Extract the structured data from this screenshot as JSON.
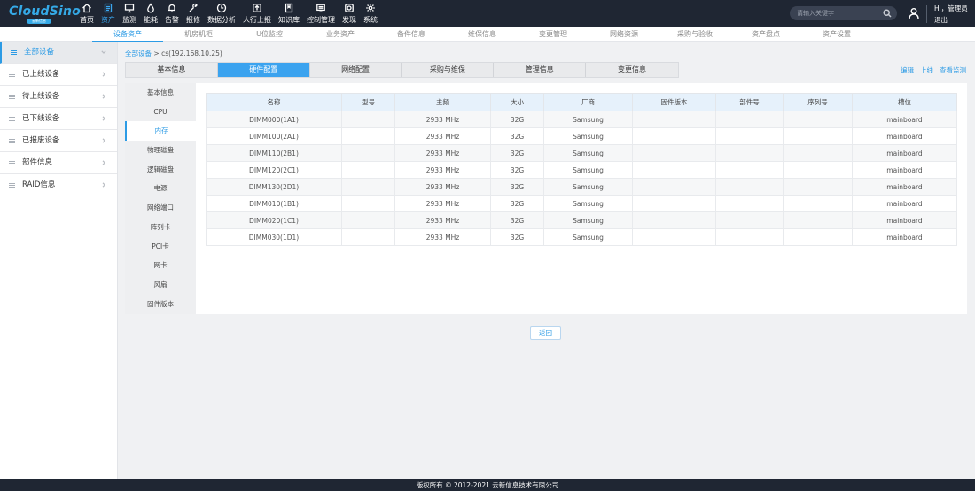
{
  "logo": {
    "brand": "CloudSino",
    "sub": "云新信息"
  },
  "nav": [
    {
      "label": "首页",
      "icon": "home-icon"
    },
    {
      "label": "资产",
      "icon": "document-icon",
      "active": true
    },
    {
      "label": "监测",
      "icon": "monitor-icon"
    },
    {
      "label": "能耗",
      "icon": "drop-icon"
    },
    {
      "label": "告警",
      "icon": "bell-icon"
    },
    {
      "label": "报修",
      "icon": "wrench-icon"
    },
    {
      "label": "数据分析",
      "icon": "clock-icon"
    },
    {
      "label": "人行上报",
      "icon": "upload-icon"
    },
    {
      "label": "知识库",
      "icon": "book-icon"
    },
    {
      "label": "控制管理",
      "icon": "bmc-icon"
    },
    {
      "label": "发现",
      "icon": "discover-icon"
    },
    {
      "label": "系统",
      "icon": "gear-icon"
    }
  ],
  "search": {
    "placeholder": "请输入关键字"
  },
  "user": {
    "greeting": "Hi，管理员",
    "logout": "退出"
  },
  "subnav": [
    "设备资产",
    "机房机柜",
    "U位监控",
    "业务资产",
    "备件信息",
    "维保信息",
    "变更管理",
    "网络资源",
    "采购与验收",
    "资产盘点",
    "资产设置"
  ],
  "sidebar": [
    "全部设备",
    "已上线设备",
    "待上线设备",
    "已下线设备",
    "已报废设备",
    "部件信息",
    "RAID信息"
  ],
  "breadcrumb": {
    "root": "全部设备",
    "sep": ">",
    "current": "cs(192.168.10.25)"
  },
  "tabs": [
    "基本信息",
    "硬件配置",
    "网络配置",
    "采购与维保",
    "管理信息",
    "变更信息"
  ],
  "actions": [
    "编辑",
    "上线",
    "查看监测"
  ],
  "hw_nav": [
    "基本信息",
    "CPU",
    "内存",
    "物理磁盘",
    "逻辑磁盘",
    "电源",
    "网络端口",
    "阵列卡",
    "PCI卡",
    "网卡",
    "风扇",
    "固件版本"
  ],
  "table": {
    "headers": [
      "名称",
      "型号",
      "主频",
      "大小",
      "厂商",
      "固件版本",
      "部件号",
      "序列号",
      "槽位"
    ],
    "rows": [
      [
        "DIMM000(1A1)",
        "",
        "2933 MHz",
        "32G",
        "Samsung",
        "",
        "",
        "",
        "mainboard"
      ],
      [
        "DIMM100(2A1)",
        "",
        "2933 MHz",
        "32G",
        "Samsung",
        "",
        "",
        "",
        "mainboard"
      ],
      [
        "DIMM110(2B1)",
        "",
        "2933 MHz",
        "32G",
        "Samsung",
        "",
        "",
        "",
        "mainboard"
      ],
      [
        "DIMM120(2C1)",
        "",
        "2933 MHz",
        "32G",
        "Samsung",
        "",
        "",
        "",
        "mainboard"
      ],
      [
        "DIMM130(2D1)",
        "",
        "2933 MHz",
        "32G",
        "Samsung",
        "",
        "",
        "",
        "mainboard"
      ],
      [
        "DIMM010(1B1)",
        "",
        "2933 MHz",
        "32G",
        "Samsung",
        "",
        "",
        "",
        "mainboard"
      ],
      [
        "DIMM020(1C1)",
        "",
        "2933 MHz",
        "32G",
        "Samsung",
        "",
        "",
        "",
        "mainboard"
      ],
      [
        "DIMM030(1D1)",
        "",
        "2933 MHz",
        "32G",
        "Samsung",
        "",
        "",
        "",
        "mainboard"
      ]
    ]
  },
  "back_button": "返回",
  "footer": "版权所有 © 2012-2021  云新信息技术有限公司",
  "colors": {
    "topbar": "#1f2633",
    "accent": "#2c9be5",
    "tab_active": "#3ba3ef"
  }
}
